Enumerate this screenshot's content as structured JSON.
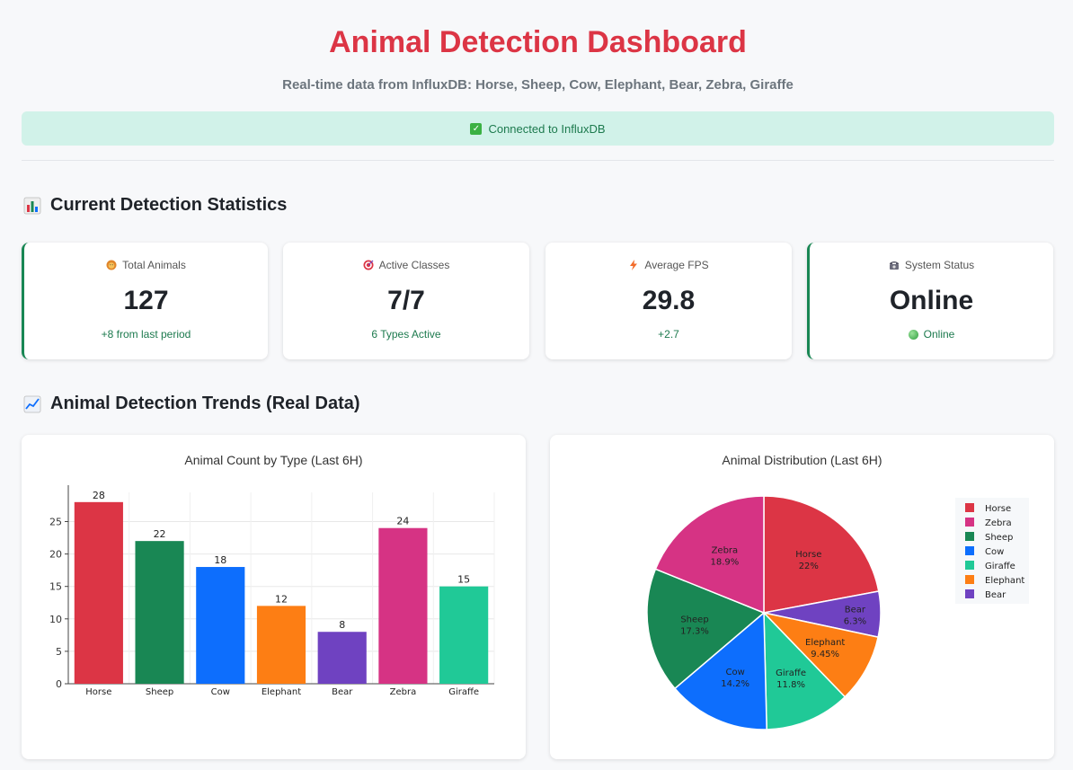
{
  "header": {
    "title": "Animal Detection Dashboard",
    "subtitle": "Real-time data from InfluxDB: Horse, Sheep, Cow, Elephant, Bear, Zebra, Giraffe",
    "connection_status": "Connected to InfluxDB"
  },
  "sections": {
    "stats_title": "Current Detection Statistics",
    "trends_title": "Animal Detection Trends (Real Data)"
  },
  "cards": [
    {
      "label": "Total Animals",
      "icon": "lion-icon",
      "value": "127",
      "sub": "+8 from last period"
    },
    {
      "label": "Active Classes",
      "icon": "target-icon",
      "value": "7/7",
      "sub": "6 Types Active"
    },
    {
      "label": "Average FPS",
      "icon": "lightning-icon",
      "value": "29.8",
      "sub": "+2.7"
    },
    {
      "label": "System Status",
      "icon": "telephone-icon",
      "value": "Online",
      "sub": "Online"
    }
  ],
  "colors": {
    "accent": "#dc3545",
    "success": "#198754",
    "Horse": "#dc3545",
    "Sheep": "#198754",
    "Cow": "#0d6efd",
    "Elephant": "#fd7e14",
    "Bear": "#6f42c1",
    "Zebra": "#d63384",
    "Giraffe": "#20c997"
  },
  "chart_data": [
    {
      "type": "bar",
      "title": "Animal Count by Type (Last 6H)",
      "categories": [
        "Horse",
        "Sheep",
        "Cow",
        "Elephant",
        "Bear",
        "Zebra",
        "Giraffe"
      ],
      "values": [
        28,
        22,
        18,
        12,
        8,
        24,
        15
      ],
      "yticks": [
        0,
        5,
        10,
        15,
        20,
        25
      ],
      "ylim": [
        0,
        29.5
      ],
      "grid": true
    },
    {
      "type": "pie",
      "title": "Animal Distribution (Last 6H)",
      "labels": [
        "Horse",
        "Bear",
        "Elephant",
        "Giraffe",
        "Cow",
        "Sheep",
        "Zebra"
      ],
      "values": [
        28,
        8,
        12,
        15,
        18,
        22,
        24
      ],
      "percent_labels": [
        "22%",
        "6.3%",
        "9.45%",
        "11.8%",
        "14.2%",
        "17.3%",
        "18.9%"
      ],
      "legend": [
        "Horse",
        "Zebra",
        "Sheep",
        "Cow",
        "Giraffe",
        "Elephant",
        "Bear"
      ],
      "legend_position": "right"
    }
  ]
}
